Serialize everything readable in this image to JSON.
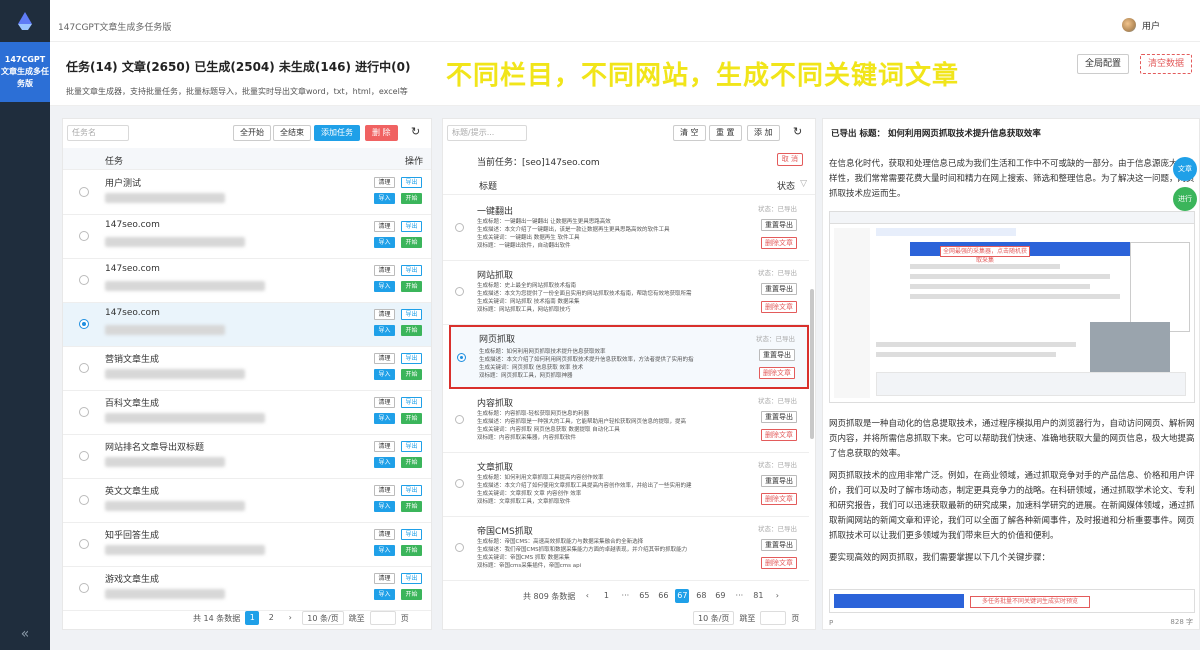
{
  "app": {
    "title": "147CGPT文章生成多任务版",
    "user": "用户"
  },
  "sidebar": {
    "menu_label": "147CGPT文章生成多任务版",
    "collapse": "«"
  },
  "header": {
    "stats": "任务(14) 文章(2650) 已生成(2504) 未生成(146) 进行中(0)",
    "subtitle": "批量文章生成器，支持批量任务，批量标题导入，批量实时导出文章word，txt，html，excel等",
    "banner": "不同栏目，不同网站，生成不同关键词文章",
    "global_config": "全局配置",
    "clear_data": "清空数据"
  },
  "tasks": {
    "search_placeholder": "任务名",
    "start_all": "全开始",
    "end_all": "全结束",
    "add_task": "添加任务",
    "delete": "删 除",
    "col_task": "任务",
    "col_action": "操作",
    "btn_edit": "清理",
    "btn_export": "导出",
    "btn_import": "导入",
    "btn_start": "开始",
    "rows": [
      {
        "name": "用户测试",
        "sub": ""
      },
      {
        "name": "147seo.com",
        "sub": ""
      },
      {
        "name": "147seo.com",
        "sub": ""
      },
      {
        "name": "147seo.com",
        "sub": ""
      },
      {
        "name": "营销文章生成",
        "sub": ""
      },
      {
        "name": "百科文章生成",
        "sub": ""
      },
      {
        "name": "网站排名文章导出双标题",
        "sub": ""
      },
      {
        "name": "英文文章生成",
        "sub": ""
      },
      {
        "name": "知乎回答生成",
        "sub": ""
      },
      {
        "name": "游戏文章生成",
        "sub": ""
      }
    ],
    "pager": {
      "total": "共 14 条数据",
      "p1": "1",
      "p2": "2",
      "size": "10 条/页",
      "jump": "跳至",
      "page": "页"
    }
  },
  "articles": {
    "search_placeholder": "标题/提示...",
    "clear": "清 空",
    "reset": "重 置",
    "add": "添 加",
    "current_task": "当前任务：[seo]147seo.com",
    "cancel": "取 消",
    "col_title": "标题",
    "col_status": "状态",
    "status_done": "状态：已导出",
    "export": "重置导出",
    "delete": "删除文章",
    "rows": [
      {
        "title": "一键翻出",
        "l1": "生成标题：一键翻出一键翻出 让数据再生更具思路高效",
        "l2": "生成描述：本文介绍了一键翻出，该是一款让数据再生更具思路高效的软件工具",
        "l3": "生成关键词：一键翻出 数据再生 软件工具",
        "l4": "双标题：一键翻出软件，自动翻出软件"
      },
      {
        "title": "网站抓取",
        "l1": "生成标题：史上最全的网站抓取技术指南",
        "l2": "生成描述：本文为您提供了一份全面且实用的网站抓取技术指南，帮助您有效地获取所需",
        "l3": "生成关键词：网站抓取 技术指南 数据采集",
        "l4": "双标题：网站抓取工具，网站抓取技巧"
      },
      {
        "title": "网页抓取",
        "l1": "生成标题：如何利用网页抓取技术提升信息获取效率",
        "l2": "生成描述：本文介绍了如何利用网页抓取技术提升信息获取效率，方法者提供了实用的指",
        "l3": "生成关键词：网页抓取 信息获取 效率 技术",
        "l4": "双标题：网页抓取工具，网页抓取神器"
      },
      {
        "title": "内容抓取",
        "l1": "生成标题：内容抓取-轻松获取网页信息的利器",
        "l2": "生成描述：内容抓取是一种强大的工具，它能帮助用户轻松获取网页信息的提取，提高",
        "l3": "生成关键词：内容抓取 网页信息获取 数据提取 自动化工具",
        "l4": "双标题：内容抓取采集器，内容抓取软件"
      },
      {
        "title": "文章抓取",
        "l1": "生成标题：如何利用文章抓取工具提高内容创作效率",
        "l2": "生成描述：本文介绍了如何使用文章抓取工具提高内容创作效率，并给出了一些实用的建",
        "l3": "生成关键词：文章抓取 文章 内容创作 效率",
        "l4": "双标题：文章抓取工具，文章抓取软件"
      },
      {
        "title": "帝国CMS抓取",
        "l1": "生成标题：帝国CMS：高速高效抓取能力与数据采集融合的全新选择",
        "l2": "生成描述：我们帝国CMS抓取和数据采集能力方面的卓越表现，并介绍其带的抓取能力",
        "l3": "生成关键词：帝国CMS 抓取 数据采集",
        "l4": "双标题：帝国cms采集插件，帝国cms api"
      }
    ],
    "pager": {
      "total": "共 809 条数据",
      "pages": [
        "1",
        "···",
        "65",
        "66",
        "67",
        "68",
        "69",
        "···",
        "81"
      ],
      "active": "67",
      "size": "10 条/页",
      "jump": "跳至",
      "page": "页"
    }
  },
  "preview": {
    "title": "已导出 标题：  如何利用网页抓取技术提升信息获取效率",
    "p1": "在信息化时代，获取和处理信息已成为我们生活和工作中不可或缺的一部分。由于信息源庞大和多样性，我们常常需要花费大量时间和精力在网上搜索、筛选和整理信息。为了解决这一问题，网页抓取技术应运而生。",
    "p2": "网页抓取是一种自动化的信息提取技术，通过程序模拟用户的浏览器行为，自动访问网页、解析网页内容，并将所需信息抓取下来。它可以帮助我们快速、准确地获取大量的网页信息，极大地提高了信息获取的效率。",
    "p3": "网页抓取技术的应用非常广泛。例如，在商业领域，通过抓取竞争对手的产品信息、价格和用户评价，我们可以及时了解市场动态，制定更具竞争力的战略。在科研领域，通过抓取学术论文、专利和研究报告，我们可以迅速获取最新的研究成果，加速科学研究的进展。在新闻媒体领域，通过抓取新闻网站的新闻文章和评论，我们可以全面了解各种新闻事件，及时报道和分析重要事件。网页抓取技术可以让我们更多领域为我们带来巨大的价值和便利。",
    "p4": "要实现高效的网页抓取，我们需要掌握以下几个关键步骤：",
    "shot_caption": "全网最强的采集器，点击随机获取采集",
    "bottom_caption": "多任务批量不同关键词生成实时预览",
    "fab_article": "文章",
    "fab_progress": "进行",
    "footer_left": "P",
    "footer_right": "828 字"
  }
}
